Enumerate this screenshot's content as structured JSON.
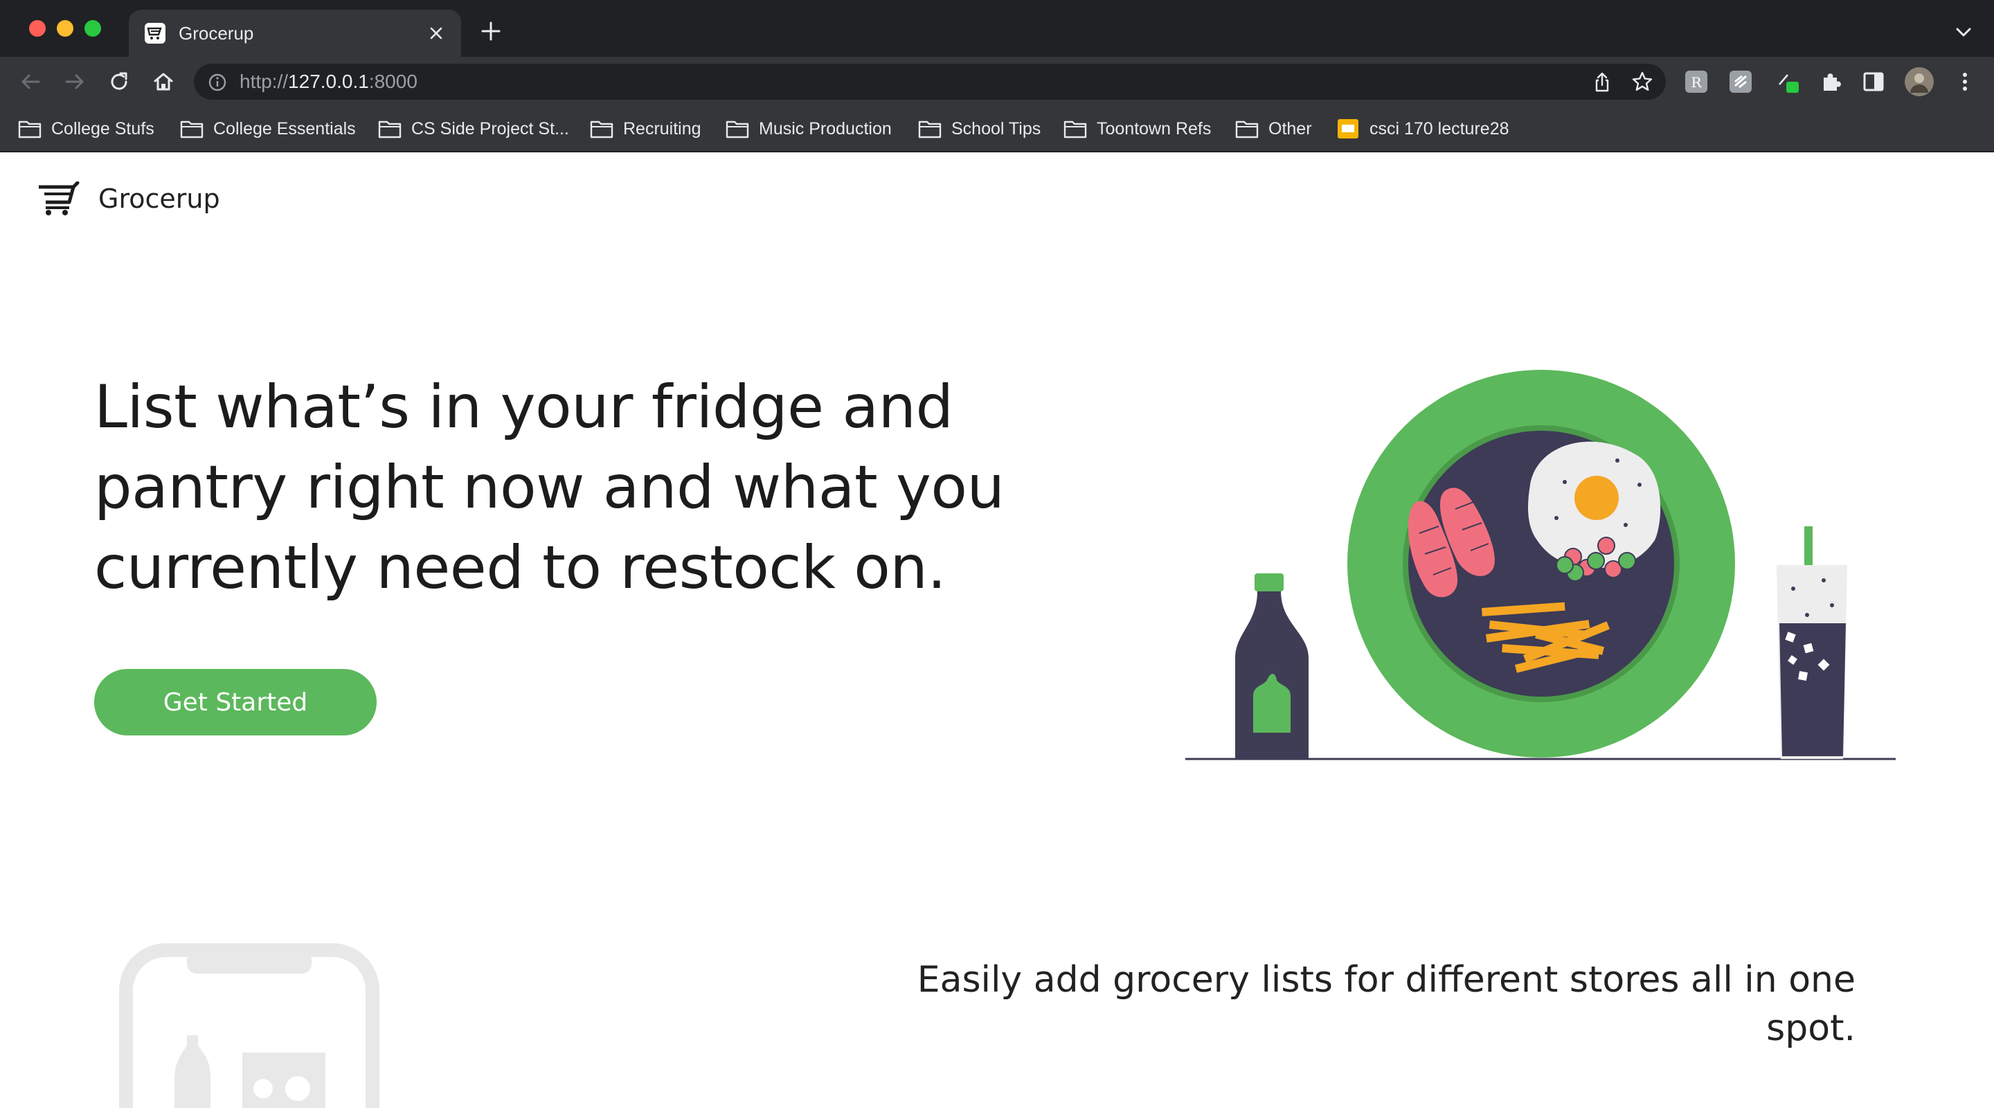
{
  "browser": {
    "tab": {
      "title": "Grocerup"
    },
    "address": {
      "scheme": "http://",
      "host": "127.0.0.1",
      "port": ":8000"
    },
    "bookmarks": [
      {
        "label": "College Stufs",
        "icon": "folder-icon"
      },
      {
        "label": "College Essentials",
        "icon": "folder-icon"
      },
      {
        "label": "CS Side Project St...",
        "icon": "folder-icon"
      },
      {
        "label": "Recruiting",
        "icon": "folder-icon"
      },
      {
        "label": "Music Production",
        "icon": "folder-icon"
      },
      {
        "label": "School Tips",
        "icon": "folder-icon"
      },
      {
        "label": "Toontown Refs",
        "icon": "folder-icon"
      },
      {
        "label": "Other",
        "icon": "folder-icon"
      },
      {
        "label": "csci 170 lecture28",
        "icon": "slides-icon"
      }
    ]
  },
  "page": {
    "brand": "Grocerup",
    "hero": {
      "headline": "List what’s in your fridge and pantry right now and what you currently need to restock on.",
      "cta": "Get Started"
    },
    "feature": {
      "text": "Easily add grocery lists for different stores all in one spot."
    }
  },
  "colors": {
    "accent": "#5cb85c",
    "plate_inner": "#3d3b56",
    "chrome_dark": "#202124",
    "chrome_mid": "#35363a"
  }
}
